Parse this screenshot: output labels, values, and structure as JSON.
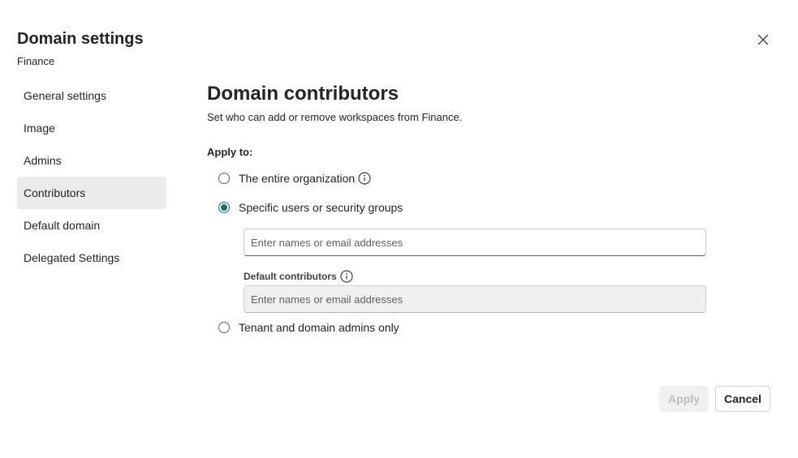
{
  "dialog": {
    "title": "Domain settings",
    "subtitle": "Finance",
    "close_icon": "close-icon"
  },
  "nav": {
    "items": [
      {
        "label": "General settings",
        "active": false
      },
      {
        "label": "Image",
        "active": false
      },
      {
        "label": "Admins",
        "active": false
      },
      {
        "label": "Contributors",
        "active": true
      },
      {
        "label": "Default domain",
        "active": false
      },
      {
        "label": "Delegated Settings",
        "active": false
      }
    ]
  },
  "main": {
    "heading": "Domain contributors",
    "description": "Set who can add or remove workspaces from Finance.",
    "apply_to_label": "Apply to:",
    "options": [
      {
        "label": "The entire organization",
        "checked": false,
        "info_icon": "info-icon"
      },
      {
        "label": "Specific users or security groups",
        "checked": true
      },
      {
        "label": "Tenant and domain admins only",
        "checked": false
      }
    ],
    "users_input": {
      "placeholder": "Enter names or email addresses",
      "value": ""
    },
    "default_contributors": {
      "label": "Default contributors",
      "info_icon": "info-icon",
      "placeholder": "Enter names or email addresses",
      "value": ""
    }
  },
  "footer": {
    "apply_label": "Apply",
    "cancel_label": "Cancel"
  },
  "colors": {
    "accent": "#117865",
    "text": "#242424",
    "nav_active_bg": "#ebebeb",
    "disabled_bg": "#f0f0f0"
  }
}
